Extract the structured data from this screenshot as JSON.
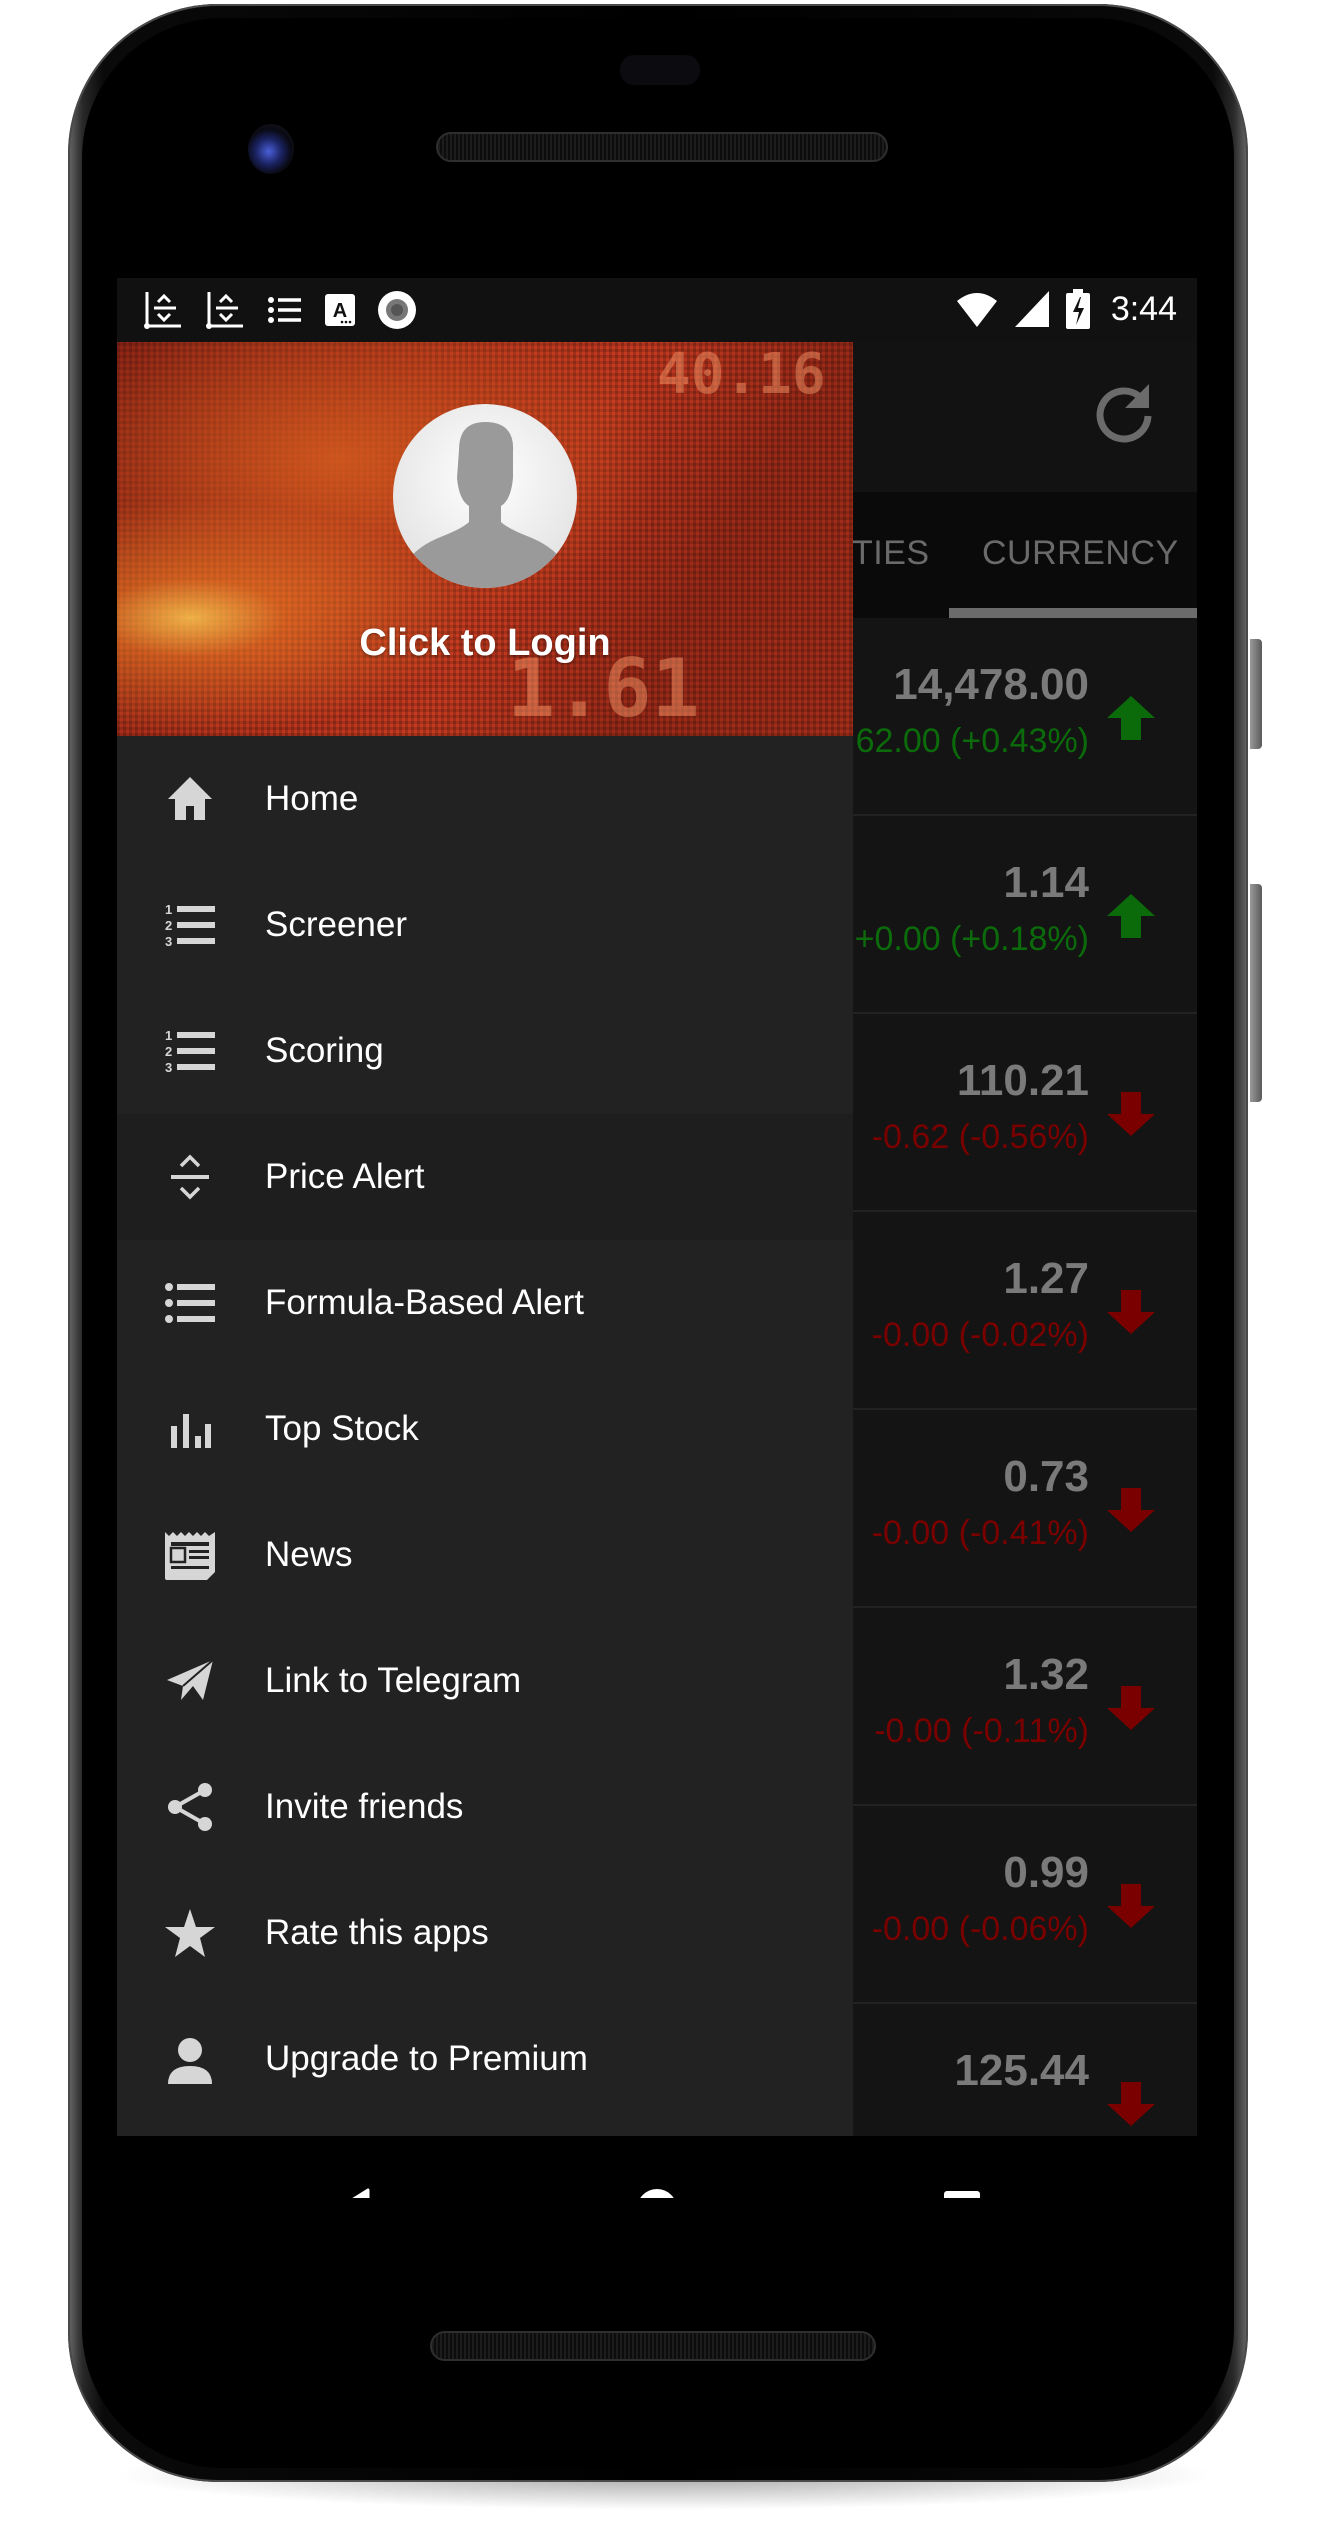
{
  "status_bar": {
    "notification_icons": [
      "price-alert-icon",
      "price-alert-icon",
      "list-icon",
      "font-a-icon",
      "record-icon"
    ],
    "wifi": "wifi-icon",
    "signal": "signal-icon",
    "battery": "battery-charging-icon",
    "time": "3:44"
  },
  "app": {
    "toolbar": {
      "refresh_icon": "refresh-icon"
    },
    "tabs": [
      {
        "label": "TIES",
        "selected": false
      },
      {
        "label": "CURRENCY",
        "selected": true
      }
    ],
    "quotes": [
      {
        "price": "14,478.00",
        "change": "62.00 (+0.43%)",
        "direction": "up"
      },
      {
        "price": "1.14",
        "change": "+0.00 (+0.18%)",
        "direction": "up"
      },
      {
        "price": "110.21",
        "change": "-0.62 (-0.56%)",
        "direction": "down"
      },
      {
        "price": "1.27",
        "change": "-0.00 (-0.02%)",
        "direction": "down"
      },
      {
        "price": "0.73",
        "change": "-0.00 (-0.41%)",
        "direction": "down"
      },
      {
        "price": "1.32",
        "change": "-0.00 (-0.11%)",
        "direction": "down"
      },
      {
        "price": "0.99",
        "change": "-0.00 (-0.06%)",
        "direction": "down"
      },
      {
        "price": "125.44",
        "change": "",
        "direction": "down"
      }
    ],
    "colors": {
      "up": "#0b6b0b",
      "down": "#7a0000",
      "price": "#7a7a7a"
    }
  },
  "drawer": {
    "header": {
      "login_label": "Click to Login",
      "ticker_top": "40.16",
      "ticker_bottom": "1.61"
    },
    "items": [
      {
        "label": "Home",
        "icon": "home-icon",
        "selected": false
      },
      {
        "label": "Screener",
        "icon": "numbered-list-icon",
        "selected": false
      },
      {
        "label": "Scoring",
        "icon": "numbered-list-icon",
        "selected": false
      },
      {
        "label": "Price Alert",
        "icon": "price-alert-icon",
        "selected": true
      },
      {
        "label": "Formula-Based Alert",
        "icon": "bulleted-list-icon",
        "selected": false
      },
      {
        "label": "Top Stock",
        "icon": "bar-chart-icon",
        "selected": false
      },
      {
        "label": "News",
        "icon": "newspaper-icon",
        "selected": false
      },
      {
        "label": "Link to Telegram",
        "icon": "telegram-icon",
        "selected": false
      },
      {
        "label": "Invite friends",
        "icon": "share-icon",
        "selected": false
      },
      {
        "label": "Rate this apps",
        "icon": "star-icon",
        "selected": false
      },
      {
        "label": "Upgrade to Premium",
        "icon": "user-icon",
        "selected": false
      }
    ]
  },
  "nav_bar": {
    "back": "back-icon",
    "home": "home-circle-icon",
    "recents": "recents-icon"
  }
}
